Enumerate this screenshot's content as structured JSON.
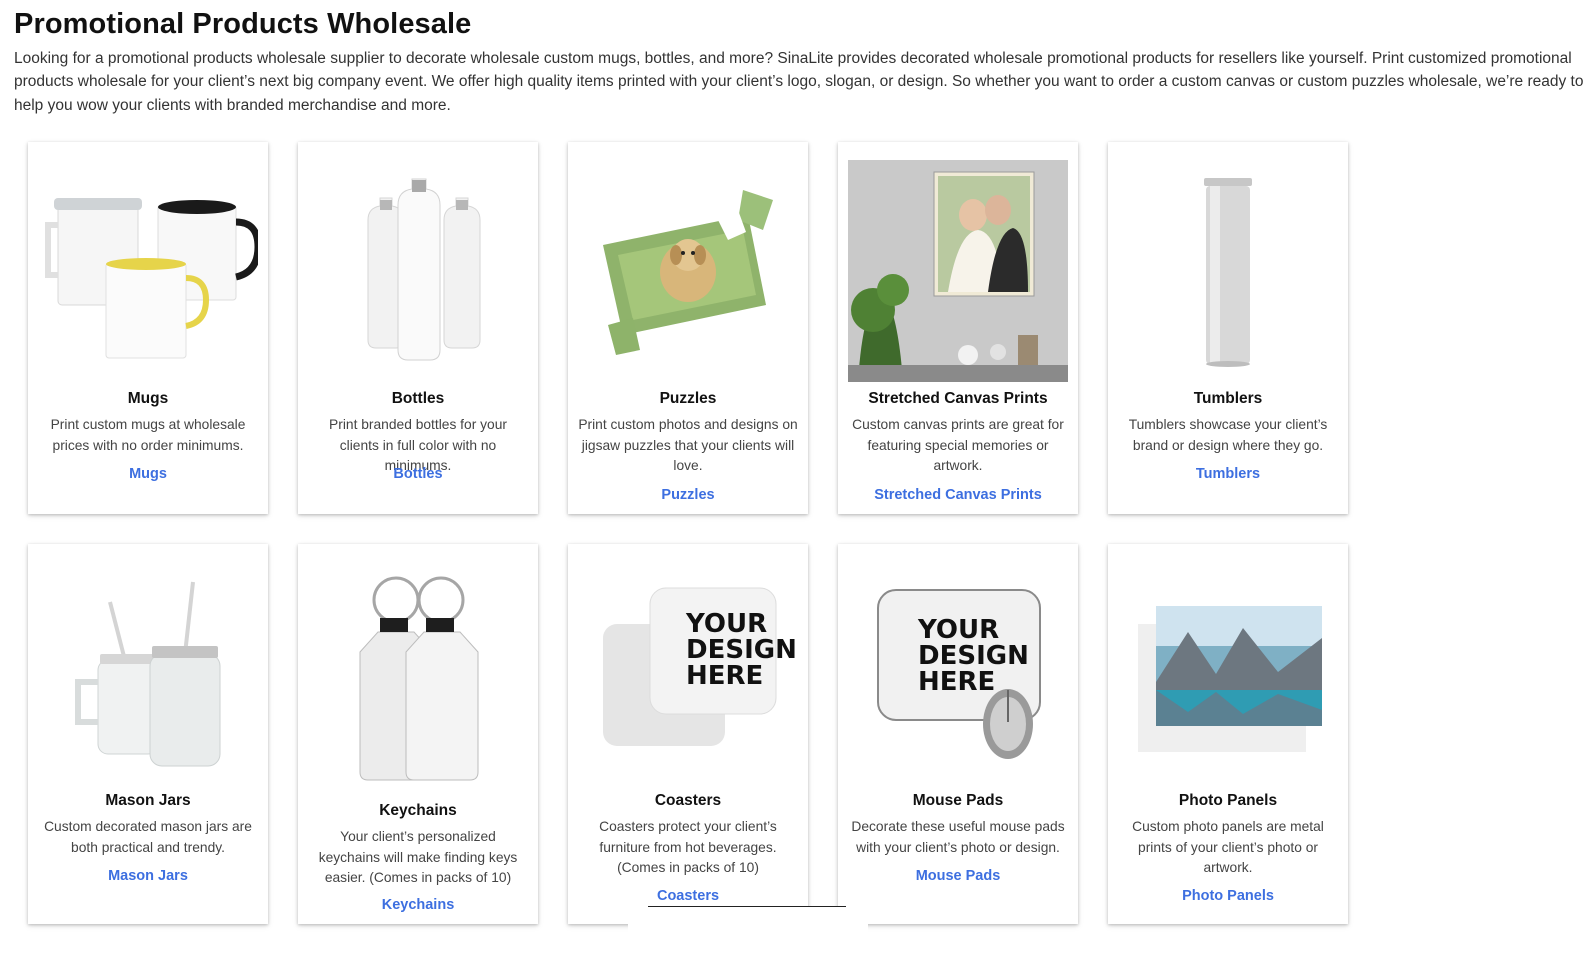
{
  "page": {
    "title": "Promotional Products Wholesale",
    "intro": "Looking for a promotional products wholesale supplier to decorate wholesale custom mugs, bottles, and more? SinaLite provides decorated wholesale promotional products for resellers like yourself. Print customized promotional products wholesale for your client’s next big company event. We offer high quality items printed with your client’s logo, slogan, or design. So whether you want to order a custom canvas or custom puzzles wholesale, we’re ready to help you wow your clients with branded merchandise and more."
  },
  "products": [
    {
      "title": "Mugs",
      "desc": "Print custom mugs at wholesale prices with no order minimums.",
      "link": "Mugs",
      "icon": "mugs-image"
    },
    {
      "title": "Bottles",
      "desc": "Print branded bottles for your clients in full color with no minimums.",
      "link": "Bottles",
      "icon": "bottles-image"
    },
    {
      "title": "Puzzles",
      "desc": "Print custom photos and designs on jigsaw puzzles that your clients will love.",
      "link": "Puzzles",
      "icon": "puzzle-image"
    },
    {
      "title": "Stretched Canvas Prints",
      "desc": "Custom canvas prints are great for featuring special memories or artwork.",
      "link": "Stretched Canvas Prints",
      "icon": "canvas-image"
    },
    {
      "title": "Tumblers",
      "desc": "Tumblers showcase your client’s brand or design where they go.",
      "link": "Tumblers",
      "icon": "tumbler-image"
    },
    {
      "title": "Mason Jars",
      "desc": "Custom decorated mason jars are both practical and trendy.",
      "link": "Mason Jars",
      "icon": "mason-jars-image"
    },
    {
      "title": "Keychains",
      "desc": "Your client’s personalized keychains will make finding keys easier. (Comes in packs of 10)",
      "link": "Keychains",
      "icon": "keychains-image"
    },
    {
      "title": "Coasters",
      "desc": "Coasters protect your client’s furniture from hot beverages. (Comes in packs of 10)",
      "link": "Coasters",
      "icon": "coasters-image"
    },
    {
      "title": "Mouse Pads",
      "desc": "Decorate these useful mouse pads with your client’s photo or design.",
      "link": "Mouse Pads",
      "icon": "mouse-pad-image"
    },
    {
      "title": "Photo Panels",
      "desc": "Custom photo panels are metal prints of your client’s photo or artwork.",
      "link": "Photo Panels",
      "icon": "photo-panel-image"
    }
  ],
  "design_text": {
    "line1": "YOUR",
    "line2": "DESIGN",
    "line3": "HERE"
  },
  "colors": {
    "link": "#3d6fe0",
    "title": "#111111",
    "body_text": "#444444"
  }
}
